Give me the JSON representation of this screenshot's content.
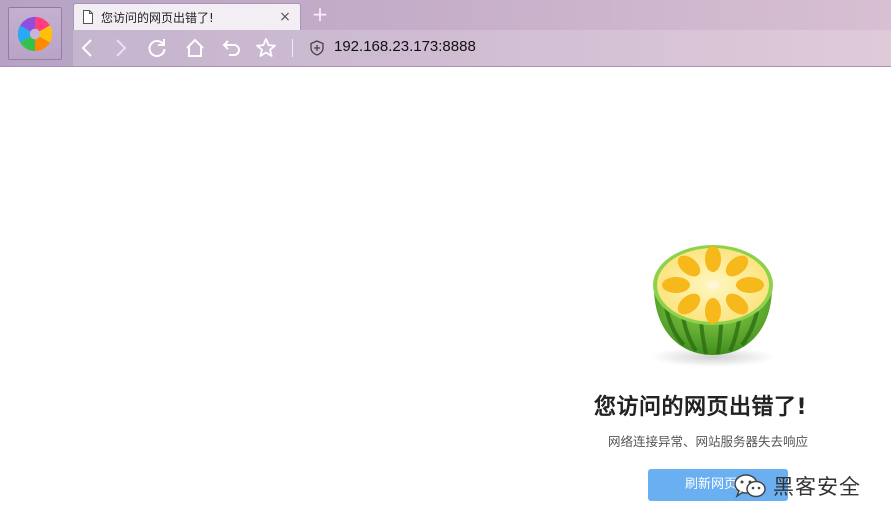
{
  "browser": {
    "tab": {
      "title": "您访问的网页出错了!",
      "close_label": "×"
    },
    "new_tab_label": "+",
    "address": {
      "url": "192.168.23.173:8888"
    }
  },
  "error_page": {
    "title": "您访问的网页出错了!",
    "description": "网络连接异常、网站服务器失去响应",
    "refresh_label": "刷新网页"
  },
  "watermark": {
    "text": "黑客安全"
  },
  "colors": {
    "chrome": "#c4adc8",
    "button_blue": "#6aaff2"
  }
}
